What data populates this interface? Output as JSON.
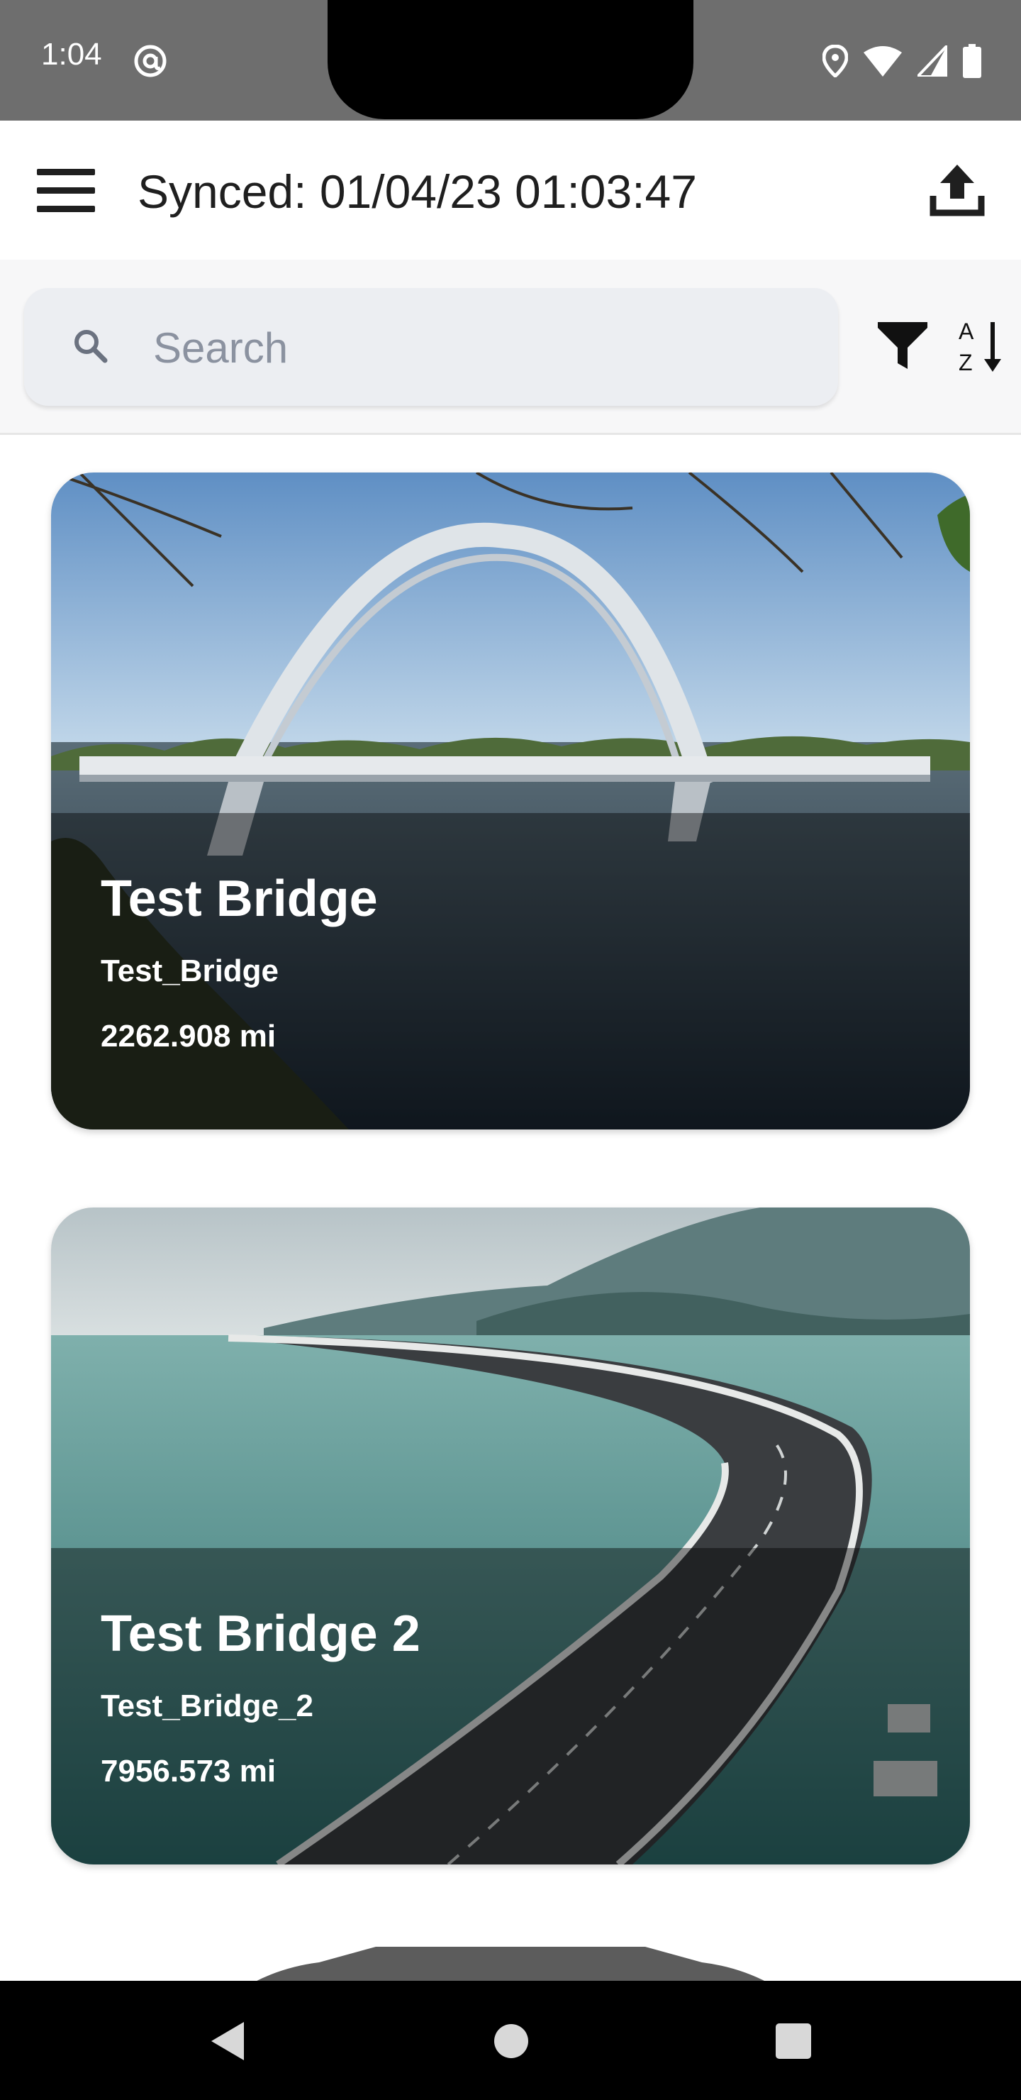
{
  "status_bar": {
    "time": "1:04",
    "icons": [
      "at-sign-icon",
      "location-icon",
      "wifi-icon",
      "cellular-signal-icon",
      "battery-icon"
    ]
  },
  "app_bar": {
    "menu_icon": "hamburger-menu-icon",
    "sync_status": "Synced: 01/04/23 01:03:47",
    "upload_icon": "upload-icon"
  },
  "search": {
    "placeholder": "Search",
    "value": "",
    "filter_icon": "filter-funnel-icon",
    "sort_icon": "sort-alpha-icon"
  },
  "bridges": [
    {
      "name": "Test Bridge",
      "code": "Test_Bridge",
      "distance": "2262.908 mi"
    },
    {
      "name": "Test Bridge 2",
      "code": "Test_Bridge_2",
      "distance": "7956.573 mi"
    }
  ],
  "nav_bar": {
    "icons": [
      "back-triangle-icon",
      "home-circle-icon",
      "recents-square-icon"
    ]
  },
  "colors": {
    "status_bar": "#6e6e6e",
    "search_box": "#eceef2",
    "text_dark": "#1f1f1f"
  }
}
